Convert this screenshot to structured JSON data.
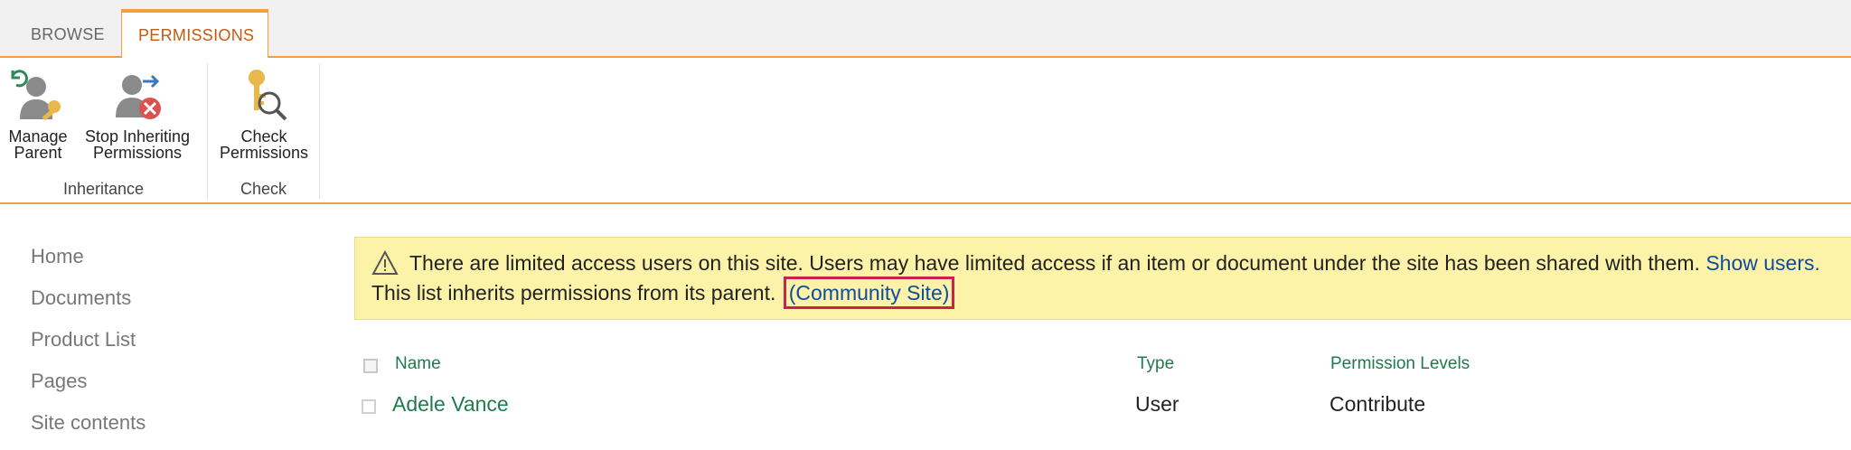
{
  "tabs": {
    "browse": "BROWSE",
    "permissions": "PERMISSIONS"
  },
  "ribbon": {
    "groups": [
      {
        "label": "Inheritance",
        "buttons": [
          {
            "line1": "Manage",
            "line2": "Parent"
          },
          {
            "line1": "Stop Inheriting",
            "line2": "Permissions"
          }
        ]
      },
      {
        "label": "Check",
        "buttons": [
          {
            "line1": "Check",
            "line2": "Permissions"
          }
        ]
      }
    ]
  },
  "nav": {
    "items": [
      "Home",
      "Documents",
      "Product List",
      "Pages",
      "Site contents"
    ]
  },
  "warning": {
    "text1": "There are limited access users on this site. Users may have limited access if an item or document under the site has been shared with them.",
    "show_users": "Show users.",
    "text2": "This list inherits permissions from its parent.",
    "parent_link": "(Community Site)"
  },
  "table": {
    "headers": {
      "name": "Name",
      "type": "Type",
      "levels": "Permission Levels"
    },
    "rows": [
      {
        "name": "Adele Vance",
        "type": "User",
        "level": "Contribute"
      }
    ]
  },
  "colors": {
    "accent": "#f0a040",
    "tab_active_text": "#c55a11",
    "link": "#0f4ba1",
    "list_green": "#1f7a4d",
    "warning_bg": "#fcf3a8",
    "highlight_box": "#cc2149"
  }
}
